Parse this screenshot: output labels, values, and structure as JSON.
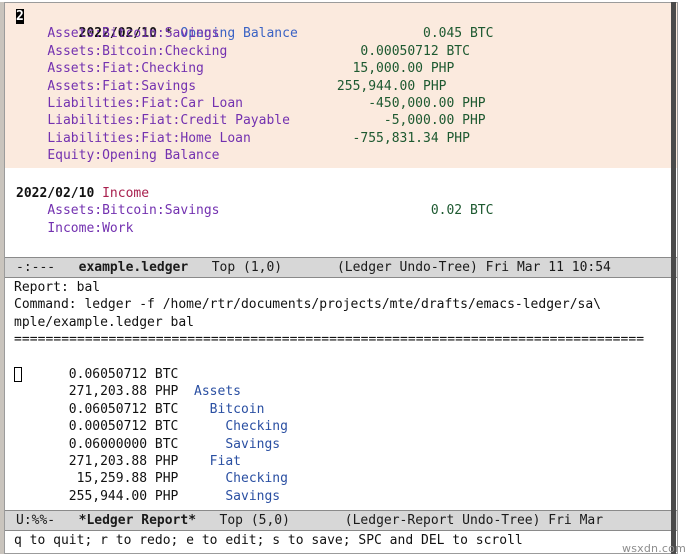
{
  "frame": {
    "background": "#ffffff",
    "border_color": "#9b9b9b",
    "modeline_background": "#d7d7d7"
  },
  "ledger_buffer": {
    "name": "example.ledger",
    "transactions": [
      {
        "highlighted": true,
        "date": "2022/02/10",
        "marker": "*",
        "payee": "Opening Balance",
        "payee_color": "#3b63c4",
        "postings": [
          {
            "account": "Assets:Bitcoin:Savings",
            "amount": "0.045",
            "commodity": "BTC"
          },
          {
            "account": "Assets:Bitcoin:Checking",
            "amount": "0.00050712",
            "commodity": "BTC"
          },
          {
            "account": "Assets:Fiat:Checking",
            "amount": "15,000.00",
            "commodity": "PHP"
          },
          {
            "account": "Assets:Fiat:Savings",
            "amount": "255,944.00",
            "commodity": "PHP"
          },
          {
            "account": "Liabilities:Fiat:Car Loan",
            "amount": "-450,000.00",
            "commodity": "PHP"
          },
          {
            "account": "Liabilities:Fiat:Credit Payable",
            "amount": "-5,000.00",
            "commodity": "PHP"
          },
          {
            "account": "Liabilities:Fiat:Home Loan",
            "amount": "-755,831.34",
            "commodity": "PHP"
          },
          {
            "account": "Equity:Opening Balance",
            "amount": "",
            "commodity": ""
          }
        ]
      },
      {
        "highlighted": false,
        "date": "2022/02/10",
        "marker": "",
        "payee": "Income",
        "payee_color": "#a8204e",
        "postings": [
          {
            "account": "Assets:Bitcoin:Savings",
            "amount": "0.02",
            "commodity": "BTC"
          },
          {
            "account": "Income:Work",
            "amount": "",
            "commodity": ""
          }
        ]
      }
    ]
  },
  "ledger_modeline": {
    "flags": "-:---",
    "buffer_name": "example.ledger",
    "position": "Top (1,0)",
    "modes": "(Ledger Undo-Tree)",
    "clock": "Fri Mar 11 10:54"
  },
  "report_buffer": {
    "name": "*Ledger Report*",
    "report_label": "Report: bal",
    "command_label": "Command: ledger -f /home/rtr/documents/projects/mte/drafts/emacs-ledger/sa\\",
    "command_wrap": "mple/example.ledger bal",
    "separator": "================================================================================",
    "rows": [
      {
        "amount": "0.06050712",
        "commodity": "BTC",
        "account": "",
        "indent": 0
      },
      {
        "amount": "271,203.88",
        "commodity": "PHP",
        "account": "Assets",
        "indent": 0
      },
      {
        "amount": "0.06050712",
        "commodity": "BTC",
        "account": "Bitcoin",
        "indent": 1
      },
      {
        "amount": "0.00050712",
        "commodity": "BTC",
        "account": "Checking",
        "indent": 2
      },
      {
        "amount": "0.06000000",
        "commodity": "BTC",
        "account": "Savings",
        "indent": 2
      },
      {
        "amount": "271,203.88",
        "commodity": "PHP",
        "account": "Fiat",
        "indent": 1
      },
      {
        "amount": "15,259.88",
        "commodity": "PHP",
        "account": "Checking",
        "indent": 2
      },
      {
        "amount": "255,944.00",
        "commodity": "PHP",
        "account": "Savings",
        "indent": 2
      }
    ]
  },
  "report_modeline": {
    "flags": "U:%%-",
    "buffer_name": "*Ledger Report*",
    "position": "Top (5,0)",
    "modes": "(Ledger-Report Undo-Tree)",
    "clock": "Fri Mar"
  },
  "echo_area": {
    "message": "q to quit; r to redo; e to edit; s to save; SPC and DEL to scroll"
  },
  "watermark": {
    "text": "wsxdn.com"
  }
}
